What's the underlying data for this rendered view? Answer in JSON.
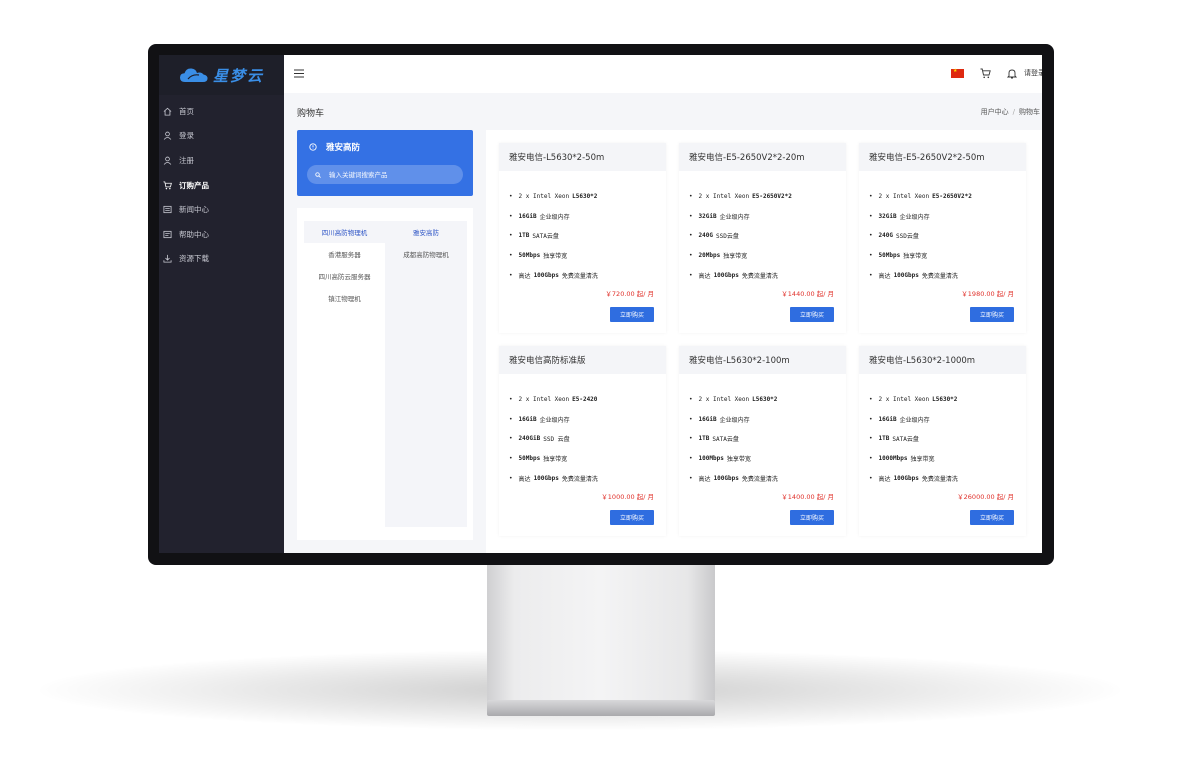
{
  "app": {
    "logo_text": "星梦云"
  },
  "sidebar": {
    "items": [
      {
        "label": "首页",
        "icon": "home-icon"
      },
      {
        "label": "登录",
        "icon": "user-icon"
      },
      {
        "label": "注册",
        "icon": "user-icon"
      },
      {
        "label": "订购产品",
        "icon": "cart-icon",
        "active": true
      },
      {
        "label": "新闻中心",
        "icon": "news-icon"
      },
      {
        "label": "帮助中心",
        "icon": "help-icon"
      },
      {
        "label": "资源下载",
        "icon": "download-icon"
      }
    ]
  },
  "topbar": {
    "login_label": "请登录",
    "icons": [
      "menu-icon",
      "china-flag-icon",
      "cart-icon",
      "bell-icon"
    ]
  },
  "page": {
    "title": "购物车",
    "breadcrumb": [
      "用户中心",
      "购物车"
    ]
  },
  "search_panel": {
    "title": "雅安高防",
    "search_placeholder": "输入关键词搜索产品"
  },
  "categories": {
    "left": [
      "四川高防物理机",
      "香港服务器",
      "四川高防云服务器",
      "镇江物理机"
    ],
    "right": [
      "雅安高防",
      "成都高防物理机"
    ]
  },
  "products": [
    {
      "name": "雅安电信-L5630*2-50m",
      "specs": [
        {
          "bold": "",
          "text": "2 x Intel Xeon",
          "tail": "L5630*2"
        },
        {
          "bold": "16GiB",
          "text": "企业级内存"
        },
        {
          "bold": "1TB",
          "text": "SATA云盘"
        },
        {
          "bold": "50Mbps",
          "text": "独享带宽"
        },
        {
          "pre": "高达",
          "bold": "100Gbps",
          "text": "免费流量清洗"
        }
      ],
      "price": "￥720.00 起/ 月",
      "button": "立即购买"
    },
    {
      "name": "雅安电信-E5-2650V2*2-20m",
      "specs": [
        {
          "bold": "",
          "text": "2 x Intel Xeon",
          "tail": "E5-2650V2*2"
        },
        {
          "bold": "32GiB",
          "text": "企业级内存"
        },
        {
          "bold": "240G",
          "text": "SSD云盘"
        },
        {
          "bold": "20Mbps",
          "text": "独享带宽"
        },
        {
          "pre": "高达",
          "bold": "100Gbps",
          "text": "免费流量清洗"
        }
      ],
      "price": "￥1440.00 起/ 月",
      "button": "立即购买"
    },
    {
      "name": "雅安电信-E5-2650V2*2-50m",
      "specs": [
        {
          "bold": "",
          "text": "2 x Intel Xeon",
          "tail": "E5-2650V2*2"
        },
        {
          "bold": "32GiB",
          "text": "企业级内存"
        },
        {
          "bold": "240G",
          "text": "SSD云盘"
        },
        {
          "bold": "50Mbps",
          "text": "独享带宽"
        },
        {
          "pre": "高达",
          "bold": "100Gbps",
          "text": "免费流量清洗"
        }
      ],
      "price": "￥1980.00 起/ 月",
      "button": "立即购买"
    },
    {
      "name": "雅安电信高防标准版",
      "specs": [
        {
          "bold": "",
          "text": "2 x Intel Xeon",
          "tail": "E5-2420"
        },
        {
          "bold": "16GiB",
          "text": "企业级内存"
        },
        {
          "bold": "240GiB",
          "text": "SSD 云盘"
        },
        {
          "bold": "50Mbps",
          "text": "独享带宽"
        },
        {
          "pre": "高达",
          "bold": "100Gbps",
          "text": "免费流量清洗"
        }
      ],
      "price": "￥1000.00 起/ 月",
      "button": "立即购买"
    },
    {
      "name": "雅安电信-L5630*2-100m",
      "specs": [
        {
          "bold": "",
          "text": "2 x Intel Xeon",
          "tail": "L5630*2"
        },
        {
          "bold": "16GiB",
          "text": "企业级内存"
        },
        {
          "bold": "1TB",
          "text": "SATA云盘"
        },
        {
          "bold": "100Mbps",
          "text": "独享带宽"
        },
        {
          "pre": "高达",
          "bold": "100Gbps",
          "text": "免费流量清洗"
        }
      ],
      "price": "￥1400.00 起/ 月",
      "button": "立即购买"
    },
    {
      "name": "雅安电信-L5630*2-1000m",
      "specs": [
        {
          "bold": "",
          "text": "2 x Intel Xeon",
          "tail": "L5630*2"
        },
        {
          "bold": "16GiB",
          "text": "企业级内存"
        },
        {
          "bold": "1TB",
          "text": "SATA云盘"
        },
        {
          "bold": "1000Mbps",
          "text": "独享带宽"
        },
        {
          "pre": "高达",
          "bold": "100Gbps",
          "text": "免费流量清洗"
        }
      ],
      "price": "￥26000.00 起/ 月",
      "button": "立即购买"
    }
  ],
  "colors": {
    "sidebar_bg": "#22222e",
    "accent": "#3471e4",
    "price": "#e0302a",
    "button": "#2f6de0"
  }
}
